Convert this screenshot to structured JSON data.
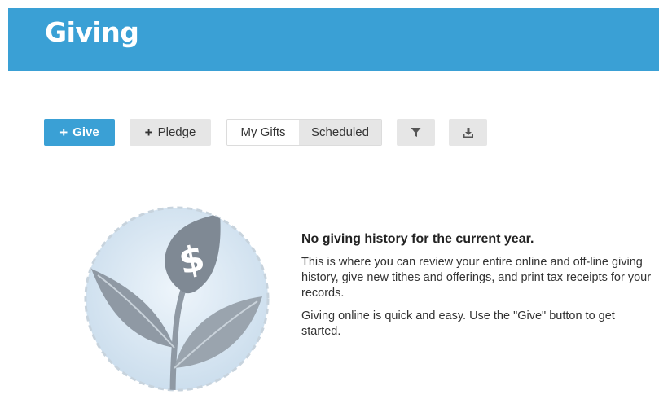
{
  "header": {
    "title": "Giving",
    "background_color": "#3aa0d5"
  },
  "toolbar": {
    "give_label": "Give",
    "pledge_label": "Pledge",
    "tabs": [
      {
        "label": "My Gifts",
        "active": true
      },
      {
        "label": "Scheduled",
        "active": false
      }
    ],
    "filter_icon": "filter-icon",
    "download_icon": "download-icon"
  },
  "empty_state": {
    "icon": "plant-dollar-icon",
    "title": "No giving history for the current year.",
    "paragraph_1": "This is where you can review your entire online and off-line giving history, give new tithes and offerings, and print tax receipts for your records.",
    "paragraph_2": "Giving online is quick and easy. Use the \"Give\" button to get started."
  }
}
